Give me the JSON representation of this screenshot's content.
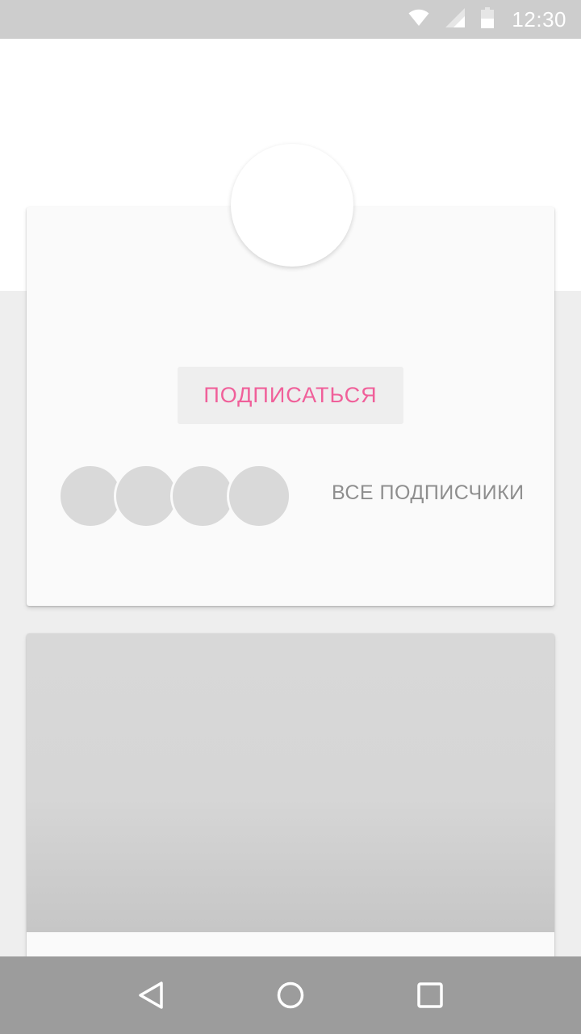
{
  "status_bar": {
    "time": "12:30",
    "icons": [
      "wifi-icon",
      "signal-icon",
      "battery-icon"
    ]
  },
  "profile": {
    "subscribe_label": "ПОДПИСАТЬСЯ",
    "all_followers_label": "ВСЕ ПОДПИСЧИКИ",
    "follower_avatar_count": 4
  },
  "nav_bar": {
    "icons": [
      "back-icon",
      "home-icon",
      "recents-icon"
    ]
  },
  "colors": {
    "accent": "#f0609a",
    "status_bar": "#cdcdcd",
    "nav_bar": "#9c9c9c",
    "background": "#eeeeee",
    "card": "#fafafa",
    "placeholder": "#d9d9d9"
  }
}
